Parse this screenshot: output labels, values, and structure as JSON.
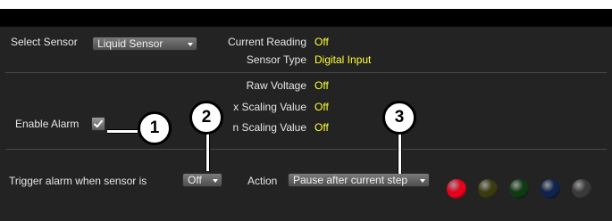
{
  "sensor": {
    "select_label": "Select Sensor",
    "selected": "Liquid Sensor"
  },
  "readings": {
    "current_reading_label": "Current Reading",
    "current_reading_value": "Off",
    "sensor_type_label": "Sensor Type",
    "sensor_type_value": "Digital Input",
    "raw_voltage_label": "Raw Voltage",
    "raw_voltage_value": "Off",
    "x_scaling_label": "x Scaling Value",
    "x_scaling_value": "Off",
    "n_scaling_label": "n Scaling Value",
    "n_scaling_value": "Off"
  },
  "alarm": {
    "enable_label": "Enable Alarm",
    "enabled": true,
    "trigger_label": "Trigger alarm when sensor is",
    "trigger_value": "Off",
    "action_label": "Action",
    "action_value": "Pause after current step"
  },
  "callouts": [
    "1",
    "2",
    "3"
  ],
  "led_colors": {
    "red": "#e8001c",
    "yellow": "#3b3a10",
    "green": "#0f3a14",
    "blue": "#10234a",
    "white": "#3a3a3a"
  },
  "colors": {
    "value_text": "#ffff33",
    "panel_bg": "#232323"
  }
}
